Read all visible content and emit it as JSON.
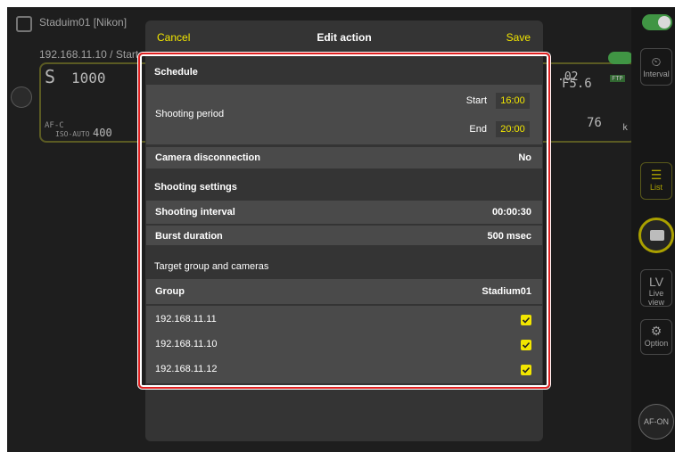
{
  "background": {
    "camera_name": "Staduim01 [Nikon]",
    "ip_line": "192.168.11.10 / Start",
    "shutter": "1000",
    "mode": "S",
    "aperture": "F5.6",
    "iso": "ISO-AUTO",
    "iso_value": "400",
    "af_mode": "AF-C",
    "remaining": "76",
    "remaining_unit": "k",
    "ftp_badge": "FTP",
    "peer_suffix": ".02"
  },
  "right_bar": {
    "interval_label": "Interval",
    "list_label": "List",
    "lv_label": "LV",
    "liveview_label": "Live view",
    "option_label": "Option",
    "afon_label": "AF-ON"
  },
  "modal": {
    "cancel_label": "Cancel",
    "title": "Edit action",
    "save_label": "Save",
    "schedule_title": "Schedule",
    "shooting_period_label": "Shooting period",
    "start_label": "Start",
    "start_value": "16:00",
    "end_label": "End",
    "end_value": "20:00",
    "camera_disconnection_label": "Camera disconnection",
    "camera_disconnection_value": "No",
    "shooting_settings_title": "Shooting settings",
    "shooting_interval_label": "Shooting interval",
    "shooting_interval_value": "00:00:30",
    "burst_duration_label": "Burst duration",
    "burst_duration_value": "500 msec",
    "target_title": "Target group and cameras",
    "group_label": "Group",
    "group_value": "Stadium01",
    "cameras": [
      {
        "ip": "192.168.11.11",
        "checked": true
      },
      {
        "ip": "192.168.11.10",
        "checked": true
      },
      {
        "ip": "192.168.11.12",
        "checked": true
      }
    ]
  },
  "colors": {
    "accent_yellow": "#f2e600",
    "highlight_red": "#e02020",
    "toggle_green": "#4caf50"
  }
}
